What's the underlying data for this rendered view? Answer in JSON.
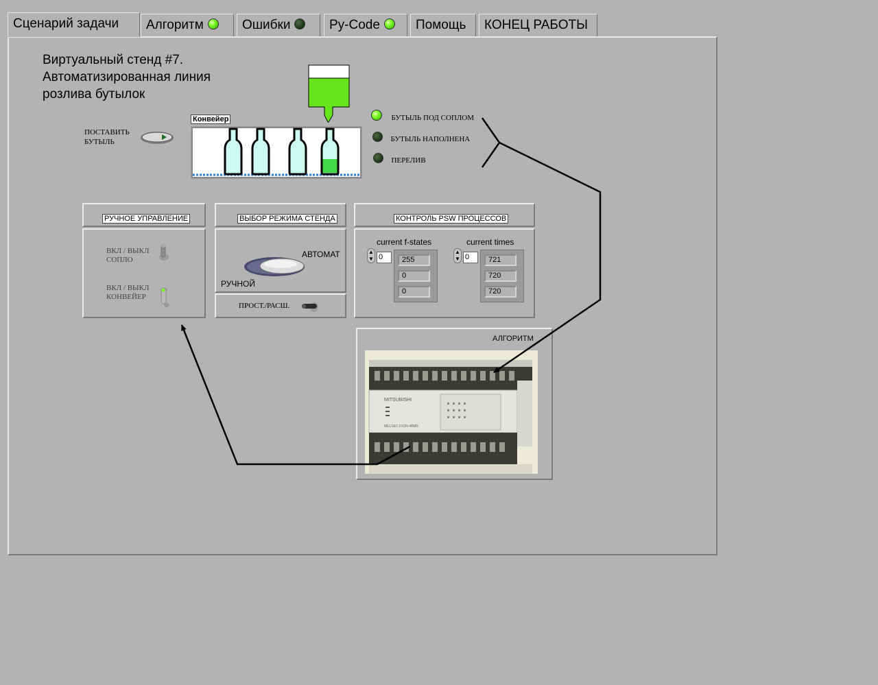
{
  "tabs": [
    {
      "label": "Сценарий задачи",
      "active": true
    },
    {
      "label": "Алгоритм",
      "led": "on"
    },
    {
      "label": "Ошибки",
      "led": "off"
    },
    {
      "label": "Py-Code",
      "led": "on"
    },
    {
      "label": "Помощь"
    },
    {
      "label": "КОНЕЦ РАБОТЫ"
    }
  ],
  "title": {
    "line1": "Виртуальный стенд #7.",
    "line2": "Автоматизированная  линия",
    "line3": "розлива бутылок"
  },
  "place_bottle": {
    "line1": "ПОСТАВИТЬ",
    "line2": "БУТЫЛЬ"
  },
  "conveyor": {
    "label": "Конвейер"
  },
  "indicators": [
    {
      "label": "БУТЫЛЬ ПОД СОПЛОМ",
      "state": "on"
    },
    {
      "label": "БУТЫЛЬ НАПОЛНЕНА",
      "state": "off"
    },
    {
      "label": "ПЕРЕЛИВ",
      "state": "off"
    }
  ],
  "manual": {
    "header": "РУЧНОЕ УПРАВЛЕНИЕ",
    "nozzle_line1": "ВКЛ / ВЫКЛ",
    "nozzle_line2": "СОПЛО",
    "conveyor_line1": "ВКЛ / ВЫКЛ",
    "conveyor_line2": "КОНВЕЙЕР"
  },
  "mode": {
    "header": "ВЫБОР РЕЖИМА СТЕНДА",
    "auto": "АВТОМАТ",
    "manual": "РУЧНОЙ",
    "simple_ext": "ПРОСТ./РАСШ."
  },
  "psw": {
    "header": "КОНТРОЛЬ PSW ПРОЦЕССОВ",
    "fstates_label": "current f-states",
    "fstates_index": "0",
    "fstates": [
      "255",
      "0",
      "0"
    ],
    "times_label": "current times",
    "times_index": "0",
    "times": [
      "721",
      "720",
      "720"
    ]
  },
  "plc": {
    "label": "АЛГОРИТМ",
    "brand": "MITSUBISHI",
    "model": "MELSEC FX2N-48MR"
  },
  "colors": {
    "background": "#b3b3b3",
    "liquid": "#66e61a",
    "bottle": "#ccfcf0",
    "led_on": "#7cff2a",
    "led_off": "#203a1a"
  }
}
